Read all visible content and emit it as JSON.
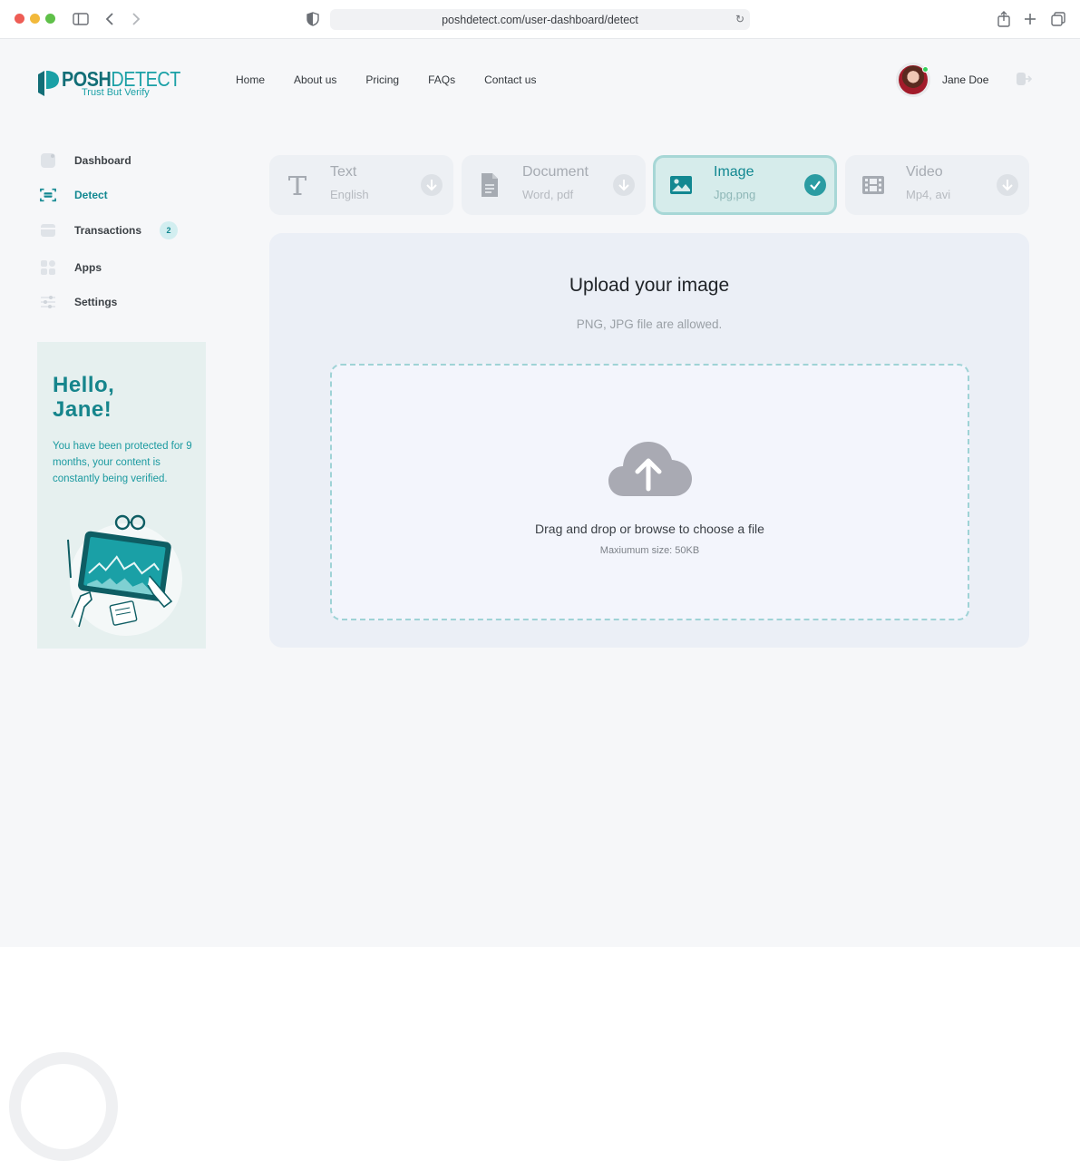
{
  "browser": {
    "url": "poshdetect.com/user-dashboard/detect"
  },
  "brand": {
    "name_bold": "POSH",
    "name_light": "DETECT",
    "tagline": "Trust But Verify",
    "accent": "#128891"
  },
  "topnav": {
    "items": [
      {
        "label": "Home"
      },
      {
        "label": "About us"
      },
      {
        "label": "Pricing"
      },
      {
        "label": "FAQs"
      },
      {
        "label": "Contact us"
      }
    ]
  },
  "user": {
    "name": "Jane Doe",
    "status": "online"
  },
  "sidebar": {
    "items": [
      {
        "label": "Dashboard",
        "icon": "dashboard-icon",
        "active": false
      },
      {
        "label": "Detect",
        "icon": "scan-icon",
        "active": true
      },
      {
        "label": "Transactions",
        "icon": "card-icon",
        "active": false,
        "badge": "2"
      },
      {
        "label": "Apps",
        "icon": "apps-grid-icon",
        "active": false
      },
      {
        "label": "Settings",
        "icon": "sliders-icon",
        "active": false
      }
    ]
  },
  "promo": {
    "title_line1": "Hello,",
    "title_line2": "Jane!",
    "text": "You have been protected for 9 months, your content is constantly being verified."
  },
  "types": [
    {
      "name": "Text",
      "sub": "English",
      "icon": "text-icon",
      "selected": false
    },
    {
      "name": "Document",
      "sub": "Word, pdf",
      "icon": "document-icon",
      "selected": false
    },
    {
      "name": "Image",
      "sub": "Jpg,png",
      "icon": "image-icon",
      "selected": true
    },
    {
      "name": "Video",
      "sub": "Mp4, avi",
      "icon": "film-icon",
      "selected": false
    }
  ],
  "upload": {
    "title": "Upload your image",
    "subtitle": "PNG, JPG file are allowed.",
    "drop_text": "Drag and drop or browse to choose a file",
    "max_size": "Maxiumum size: 50KB"
  }
}
